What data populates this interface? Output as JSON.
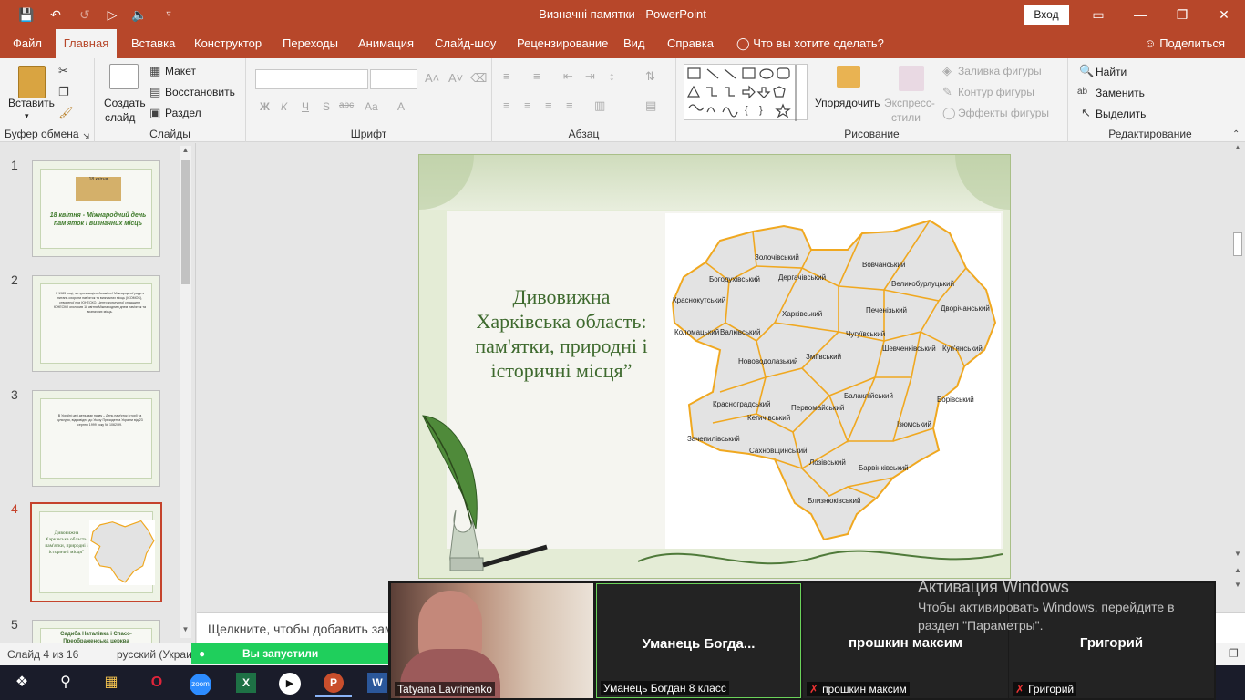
{
  "window": {
    "title": "Визначні памятки  -  PowerPoint",
    "signin_label": "Вход",
    "quick_access": [
      "save-icon",
      "undo-icon",
      "redo-icon",
      "start-from-beginning-icon",
      "speaker-icon",
      "customize-icon"
    ]
  },
  "tabs": [
    "Файл",
    "Главная",
    "Вставка",
    "Конструктор",
    "Переходы",
    "Анимация",
    "Слайд-шоу",
    "Рецензирование",
    "Вид",
    "Справка"
  ],
  "active_tab": "Главная",
  "tell_me": "Что вы хотите сделать?",
  "share_label": "Поделиться",
  "ribbon": {
    "clipboard": {
      "paste": "Вставить",
      "label": "Буфер обмена"
    },
    "slides": {
      "new_slide_line1": "Создать",
      "new_slide_line2": "слайд",
      "layout": "Макет",
      "reset": "Восстановить",
      "section": "Раздел",
      "label": "Слайды"
    },
    "font": {
      "label": "Шрифт",
      "buttons": [
        "Ж",
        "К",
        "Ч",
        "S",
        "abc",
        "Aa",
        "A"
      ]
    },
    "paragraph": {
      "label": "Абзац"
    },
    "drawing": {
      "arrange": "Упорядочить",
      "quick_styles_line1": "Экспресс-",
      "quick_styles_line2": "стили",
      "shape_fill": "Заливка фигуры",
      "shape_outline": "Контур фигуры",
      "shape_effects": "Эффекты фигуры",
      "label": "Рисование"
    },
    "editing": {
      "find": "Найти",
      "replace": "Заменить",
      "select": "Выделить",
      "label": "Редактирование"
    }
  },
  "thumbnails": [
    {
      "num": "1",
      "text": "18 квітня - Міжнародний день пам'яток і визначних місць",
      "badge": "18 квітня"
    },
    {
      "num": "2",
      "text": "У 1983 році, за пропозицією Асамблеї Міжнародної ради з питань охорони пам'яток та визначних місць (ICOMOS), створеної при ЮНЕСКО, Центр культурної спадщини ЮНЕСКО оголосив 18 квітня Міжнародним днем пам'яток та визначних місць."
    },
    {
      "num": "3",
      "text": "В Україні цей день має назву – День пам'яток історії та культури, відповідно до Указу Президента України від 23 серпня 1999 року № 1062/99."
    },
    {
      "num": "4",
      "text": "Дивовижна Харківська область: пам'ятки, природні і історичні місця”"
    },
    {
      "num": "5",
      "text": "Садиба Наталівка і Спасо-Преображенська церква"
    }
  ],
  "selected_slide": 4,
  "slide": {
    "title": "Дивовижна Харківська область: пам'ятки, природні і історичні місця”",
    "map_districts": [
      "Золочівський",
      "Богодухівський",
      "Дергачівський",
      "Вовчанський",
      "Великобурлуцький",
      "Краснокутський",
      "Харківський",
      "Печенізький",
      "Дворічанський",
      "Коломацький",
      "Валківський",
      "Чугуївський",
      "Шевченківський",
      "Куп'янський",
      "Нововодолазький",
      "Зміївський",
      "Балаклійський",
      "Борівський",
      "Красноградський",
      "Первомайський",
      "Кегичівський",
      "Ізюмський",
      "Зачепилівський",
      "Сахновщинський",
      "Лозівський",
      "Барвінківський",
      "Близнюківський"
    ]
  },
  "notes_placeholder": "Щелкните, чтобы добавить заметки",
  "status": {
    "slide_info": "Слайд 4 из 16",
    "language": "русский (Украина)"
  },
  "zoom": {
    "share_banner": "Вы запустили демонстрацию экрана",
    "participants": [
      {
        "name": "Tatyana Lavrinenko",
        "video": true,
        "muted": false
      },
      {
        "name": "Уманець Богдан 8 класс",
        "display": "Уманець  Богда...",
        "video": false,
        "muted": false,
        "active": true
      },
      {
        "name": "прошкин максим",
        "display": "прошкин максим",
        "video": false,
        "muted": true
      },
      {
        "name": "Григорий",
        "display": "Григорий",
        "video": false,
        "muted": true
      }
    ]
  },
  "windows_activation": {
    "title": "Активация Windows",
    "message": "Чтобы активировать Windows, перейдите в раздел \"Параметры\"."
  },
  "taskbar": [
    "windows-start-icon",
    "search-icon",
    "file-explorer-icon",
    "opera-icon",
    "zoom-icon",
    "excel-icon",
    "media-player-icon",
    "powerpoint-icon",
    "word-icon"
  ],
  "colors": {
    "accent": "#b7472a",
    "zoom_green": "#1fcf5c",
    "map_border": "#f0a820",
    "map_fill": "#e3e3e3",
    "slide_title": "#3e6a2e"
  }
}
